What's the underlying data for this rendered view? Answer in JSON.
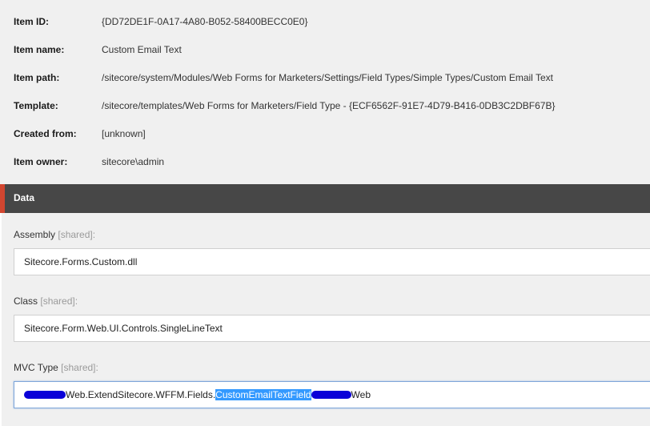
{
  "info": {
    "item_id_label": "Item ID:",
    "item_id_value": "{DD72DE1F-0A17-4A80-B052-58400BECC0E0}",
    "item_name_label": "Item name:",
    "item_name_value": "Custom Email Text",
    "item_path_label": "Item path:",
    "item_path_value": "/sitecore/system/Modules/Web Forms for Marketers/Settings/Field Types/Simple Types/Custom Email Text",
    "template_label": "Template:",
    "template_value": "/sitecore/templates/Web Forms for Marketers/Field Type - {ECF6562F-91E7-4D79-B416-0DB3C2DBF67B}",
    "created_from_label": "Created from:",
    "created_from_value": "[unknown]",
    "item_owner_label": "Item owner:",
    "item_owner_value": "sitecore\\admin"
  },
  "section": {
    "title": "Data",
    "accent_color": "#d24630",
    "bar_color": "#474747"
  },
  "fields": {
    "assembly": {
      "label": "Assembly",
      "shared": "[shared]:",
      "value": "Sitecore.Forms.Custom.dll"
    },
    "class": {
      "label": "Class",
      "shared": "[shared]:",
      "value": "Sitecore.Form.Web.UI.Controls.SingleLineText"
    },
    "mvc_type": {
      "label": "MVC Type",
      "shared": "[shared]:",
      "value_part1": "Web.ExtendSitecore.WFFM.Fields.",
      "value_selected": "CustomEmailTextField",
      "value_part2": "Web"
    }
  }
}
